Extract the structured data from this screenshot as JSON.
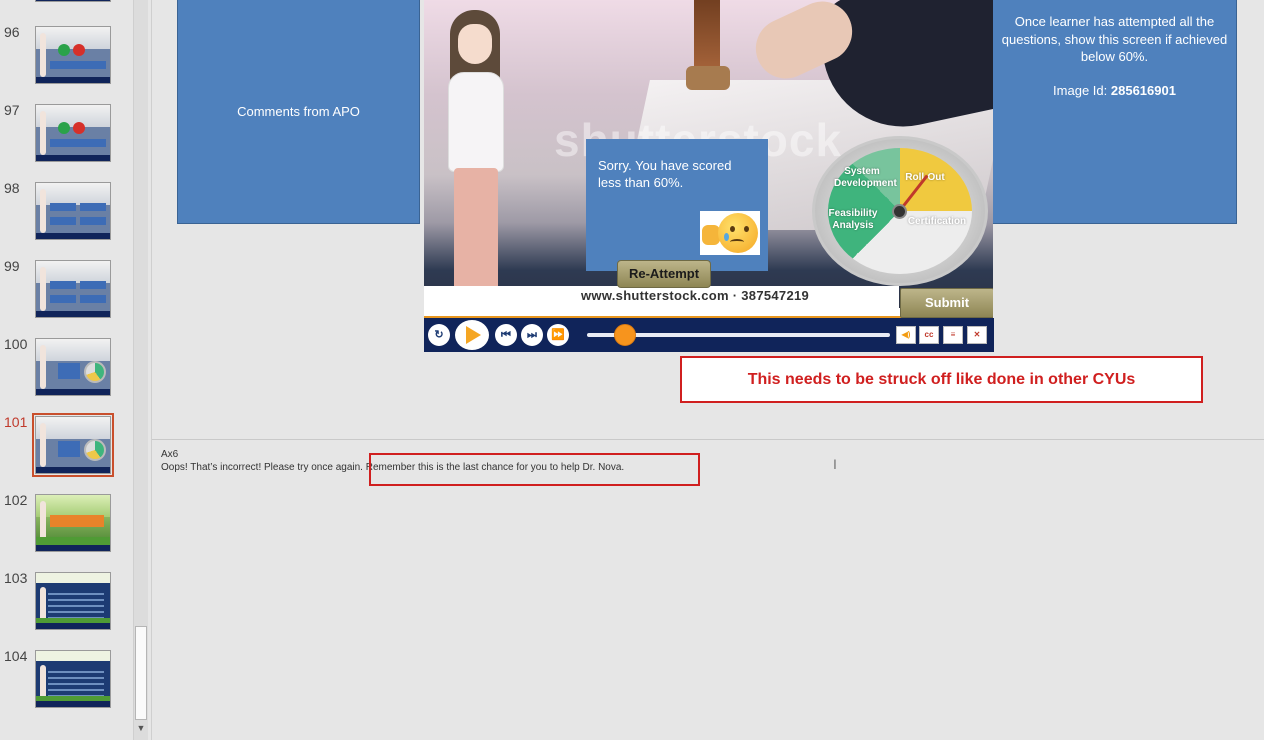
{
  "sidebar": {
    "slides": [
      {
        "num": "96",
        "style": "quiz"
      },
      {
        "num": "97",
        "style": "quiz"
      },
      {
        "num": "98",
        "style": "options"
      },
      {
        "num": "99",
        "style": "options"
      },
      {
        "num": "100",
        "style": "gauge"
      },
      {
        "num": "101",
        "style": "gauge",
        "active": true
      },
      {
        "num": "102",
        "style": "green"
      },
      {
        "num": "103",
        "style": "navy"
      },
      {
        "num": "104",
        "style": "navy"
      }
    ]
  },
  "slide": {
    "left_panel_text": "Comments from APO",
    "right_panel_text": "Once learner has attempted all the questions, show this screen if achieved below 60%.",
    "right_panel_image_label": "Image Id:",
    "right_panel_image_id": "285616901",
    "watermark": "shutterstock",
    "feedback_text": "Sorry. You have scored less than 60%.",
    "reattempt_label": "Re-Attempt",
    "submit_label": "Submit",
    "watermark_url": "www.shutterstock.com · 387547219",
    "gauge": {
      "label_system": "System Development",
      "label_rollout": "Roll-Out",
      "label_feasibility": "Feasibility Analysis",
      "label_certification": "Certification"
    },
    "player": {
      "cc_label": "cc",
      "sub_label": "≡",
      "close_label": "✕"
    }
  },
  "annotation_text": "This needs to be struck off like done in other CYUs",
  "notes": {
    "line1": "Ax6",
    "line2": "Oops! That’s incorrect! Please try once again. Remember this is the last chance for you to help Dr. Nova."
  },
  "colors": {
    "panel_blue": "#4f81bd",
    "annotation_red": "#d01f1f",
    "player_navy": "#10245a",
    "progress_orange": "#f7941d"
  }
}
